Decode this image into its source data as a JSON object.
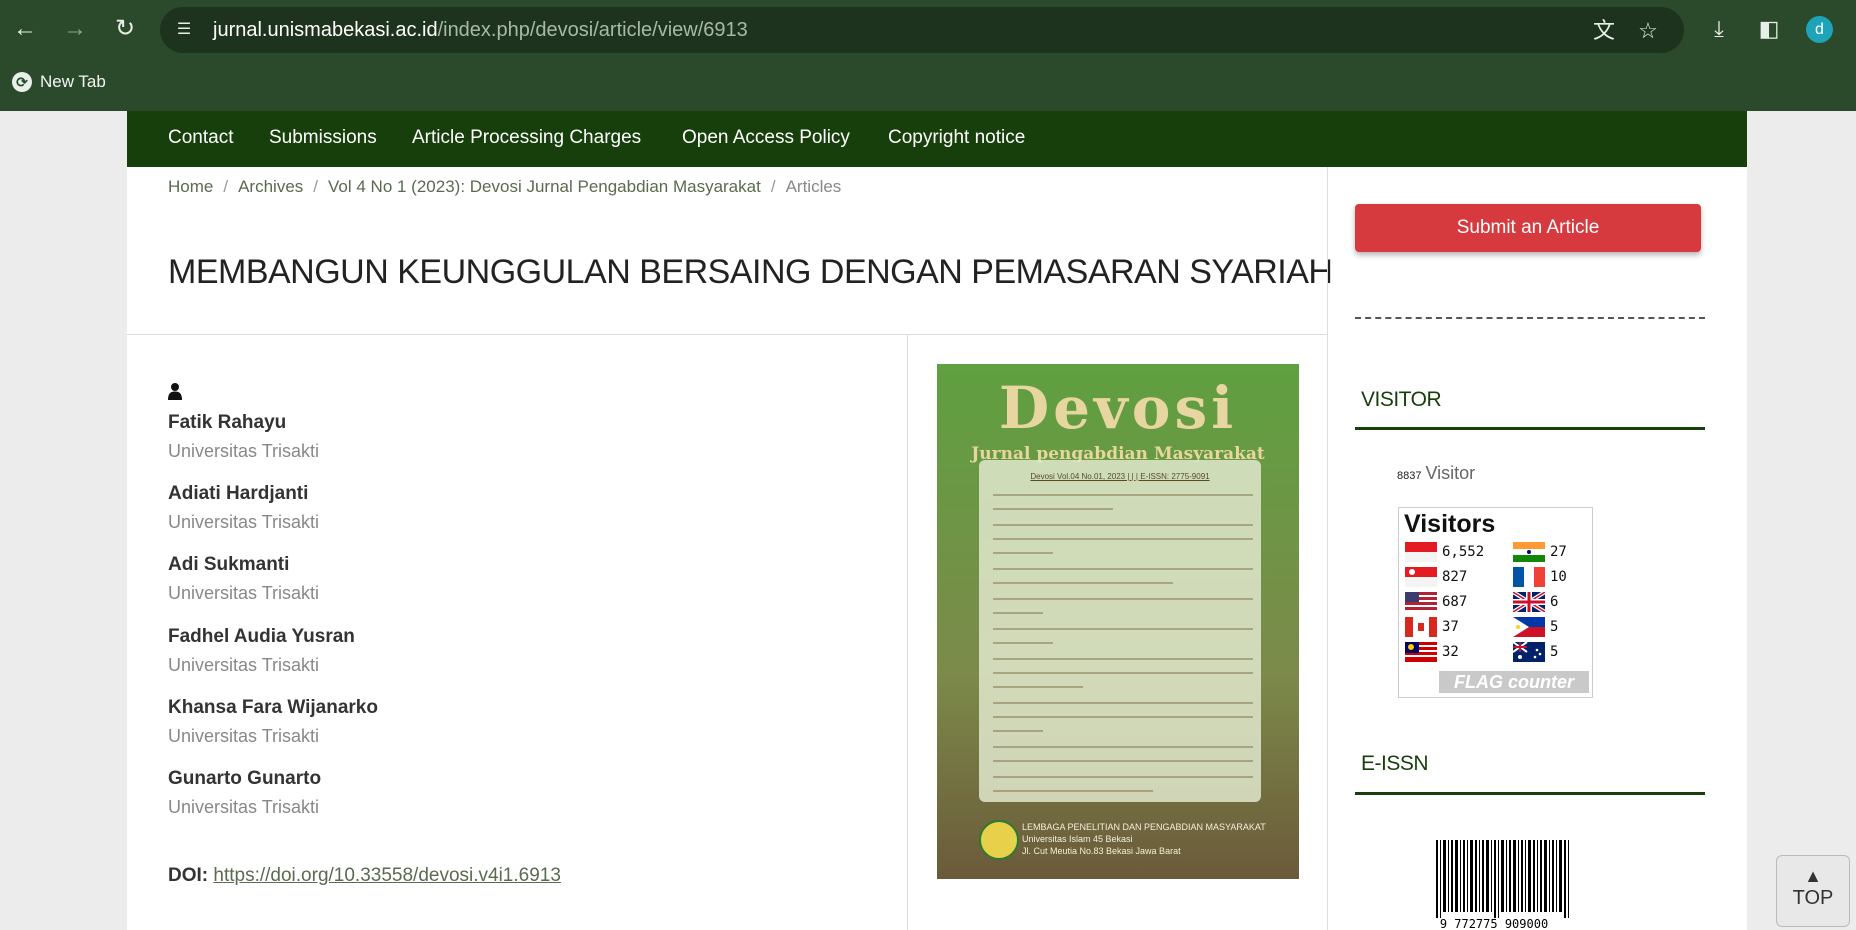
{
  "browser": {
    "url_host": "jurnal.unismabekasi.ac.id",
    "url_path": "/index.php/devosi/article/view/6913",
    "bookmark_label": "New Tab",
    "profile_initial": "d"
  },
  "nav": {
    "items": [
      "Contact",
      "Submissions",
      "Article Processing Charges",
      "Open Access Policy",
      "Copyright notice"
    ]
  },
  "breadcrumb": {
    "home": "Home",
    "archives": "Archives",
    "issue": "Vol 4 No 1 (2023): Devosi Jurnal Pengabdian Masyarakat",
    "current": "Articles",
    "separator": "/"
  },
  "article": {
    "title": "MEMBANGUN KEUNGGULAN BERSAING DENGAN PEMASARAN SYARIAH",
    "authors": [
      {
        "name": "Fatik Rahayu",
        "affiliation": "Universitas Trisakti"
      },
      {
        "name": "Adiati Hardjanti",
        "affiliation": "Universitas Trisakti"
      },
      {
        "name": "Adi Sukmanti",
        "affiliation": "Universitas Trisakti"
      },
      {
        "name": "Fadhel Audia Yusran",
        "affiliation": "Universitas Trisakti"
      },
      {
        "name": "Khansa Fara Wijanarko",
        "affiliation": "Universitas Trisakti"
      },
      {
        "name": "Gunarto Gunarto",
        "affiliation": "Universitas Trisakti"
      }
    ],
    "doi_label": "DOI:",
    "doi_url": "https://doi.org/10.33558/devosi.v4i1.6913"
  },
  "cover": {
    "title": "Devosi",
    "subtitle": "Jurnal pengabdian Masyarakat",
    "issue_line": "Devosi Vol.04 No.01, 2023 | | | E-ISSN: 2775-9091",
    "footer_1": "LEMBAGA PENELITIAN DAN PENGABDIAN MASYARAKAT",
    "footer_2": "Universitas Islam 45 Bekasi",
    "footer_3": "Jl. Cut Meutia No.83 Bekasi Jawa Barat"
  },
  "sidebar": {
    "submit_label": "Submit an Article",
    "visitor_heading": "VISITOR",
    "visitor_count": "8837",
    "visitor_label": "Visitor",
    "flag_counter": {
      "heading": "Visitors",
      "left": [
        {
          "country": "Indonesia",
          "count": "6,552"
        },
        {
          "country": "Singapore",
          "count": "827"
        },
        {
          "country": "United States",
          "count": "687"
        },
        {
          "country": "Canada",
          "count": "37"
        },
        {
          "country": "Malaysia",
          "count": "32"
        }
      ],
      "right": [
        {
          "country": "India",
          "count": "27"
        },
        {
          "country": "France",
          "count": "10"
        },
        {
          "country": "United Kingdom",
          "count": "6"
        },
        {
          "country": "Philippines",
          "count": "5"
        },
        {
          "country": "Australia",
          "count": "5"
        }
      ],
      "logo": "FLAG counter"
    },
    "eissn_heading": "E-ISSN",
    "barcode_number": "9 772775 909000"
  },
  "top_button": "TOP"
}
